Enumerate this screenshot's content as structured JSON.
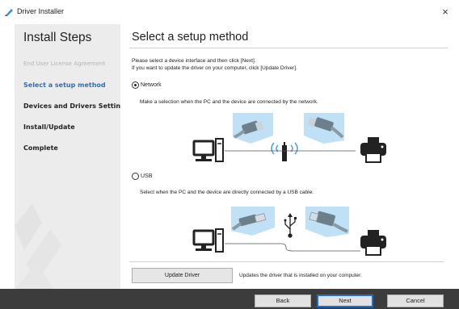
{
  "window": {
    "title": "Driver Installer",
    "close_glyph": "×"
  },
  "sidebar": {
    "heading": "Install Steps",
    "steps": [
      {
        "label": "End User License Agreement",
        "state": "done"
      },
      {
        "label": "Select a setup method",
        "state": "current"
      },
      {
        "label": "Devices and Drivers Settings",
        "state": "future"
      },
      {
        "label": "Install/Update",
        "state": "future"
      },
      {
        "label": "Complete",
        "state": "future"
      }
    ]
  },
  "main": {
    "heading": "Select a setup method",
    "instruction_line1": "Please select a device interface and then click [Next].",
    "instruction_line2": "If you want to update the driver on your computer, click [Update Driver].",
    "options": [
      {
        "label": "Network",
        "checked": true,
        "description": "Make a selection when the PC and the device are connected by the network."
      },
      {
        "label": "USB",
        "checked": false,
        "description": "Select when the PC and the device are directly connected by a USB cable."
      }
    ],
    "update_button": "Update Driver",
    "update_description": "Updates the driver that is installed on your computer."
  },
  "footer": {
    "back": "Back",
    "next": "Next",
    "cancel": "Cancel"
  },
  "colors": {
    "accent": "#2f6fb6",
    "illustration_panel": "#bfe0f5",
    "footer_bg": "#3c3c3c",
    "sidebar_bg": "#ececec"
  }
}
